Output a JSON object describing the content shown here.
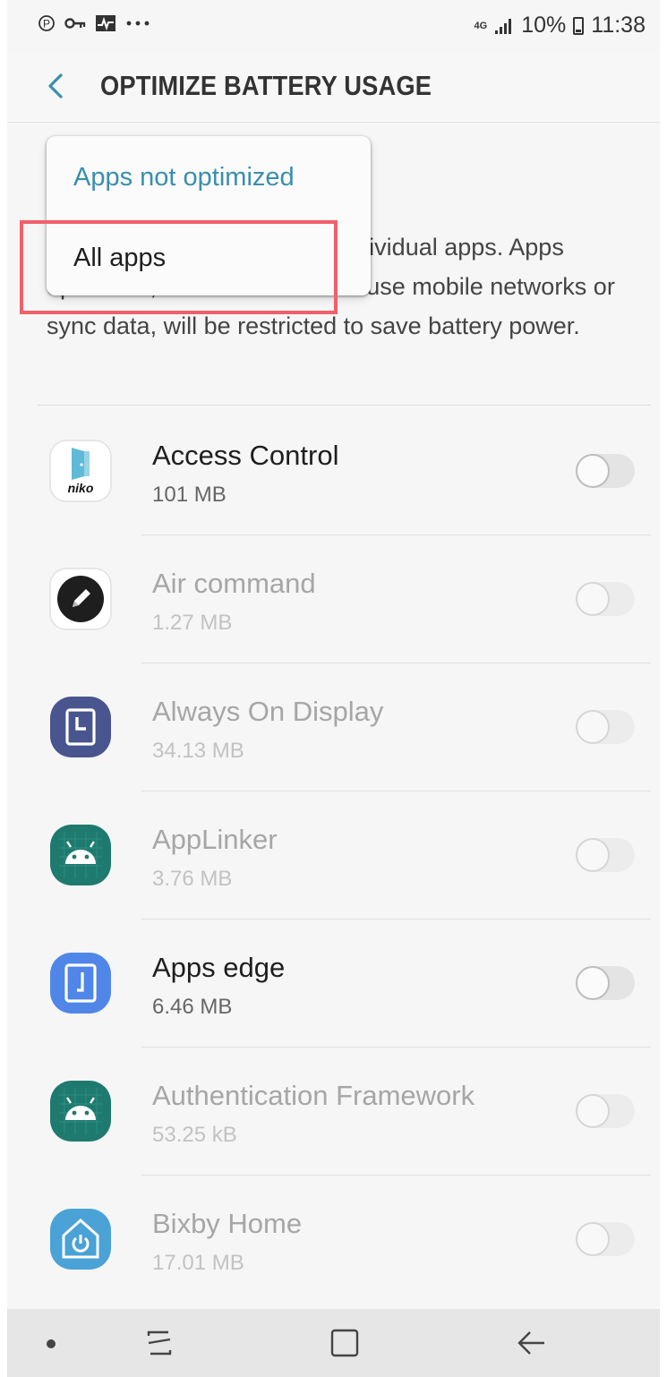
{
  "status_bar": {
    "left_icons": [
      "nfc-icon",
      "vpn-key-icon",
      "activity-icon",
      "more-notifications-icon"
    ],
    "network": "4G",
    "battery": "10%",
    "time": "11:38"
  },
  "header": {
    "title": "OPTIMIZE BATTERY USAGE",
    "back_icon": "back-chevron-icon"
  },
  "description": "Optimize battery usage for individual apps. Apps optimized, such as those that use mobile networks or sync data, will be restricted to save battery power.",
  "dropdown": {
    "selected": "Apps not optimized",
    "options": [
      "Apps not optimized",
      "All apps"
    ],
    "highlighted_option": "All apps"
  },
  "apps": [
    {
      "name": "Access Control",
      "size": "101 MB",
      "icon": "niko-access-control-icon",
      "enabled": true,
      "optimized": false
    },
    {
      "name": "Air command",
      "size": "1.27 MB",
      "icon": "air-command-pen-icon",
      "enabled": false,
      "optimized": false
    },
    {
      "name": "Always On Display",
      "size": "34.13 MB",
      "icon": "always-on-display-clock-icon",
      "enabled": false,
      "optimized": false
    },
    {
      "name": "AppLinker",
      "size": "3.76 MB",
      "icon": "android-robot-icon",
      "enabled": false,
      "optimized": false
    },
    {
      "name": "Apps edge",
      "size": "6.46 MB",
      "icon": "apps-edge-panel-icon",
      "enabled": true,
      "optimized": false
    },
    {
      "name": "Authentication Framework",
      "size": "53.25 kB",
      "icon": "android-robot-icon",
      "enabled": false,
      "optimized": false
    },
    {
      "name": "Bixby Home",
      "size": "17.01 MB",
      "icon": "bixby-home-icon",
      "enabled": false,
      "optimized": false
    }
  ],
  "icon_labels": {
    "access_control": "niko"
  },
  "nav_bar": {
    "buttons": [
      "recent-apps-icon",
      "home-icon",
      "back-icon"
    ]
  },
  "colors": {
    "accent": "#3a8ead",
    "highlight_box": "#f0606a",
    "background": "#f6f6f6"
  }
}
